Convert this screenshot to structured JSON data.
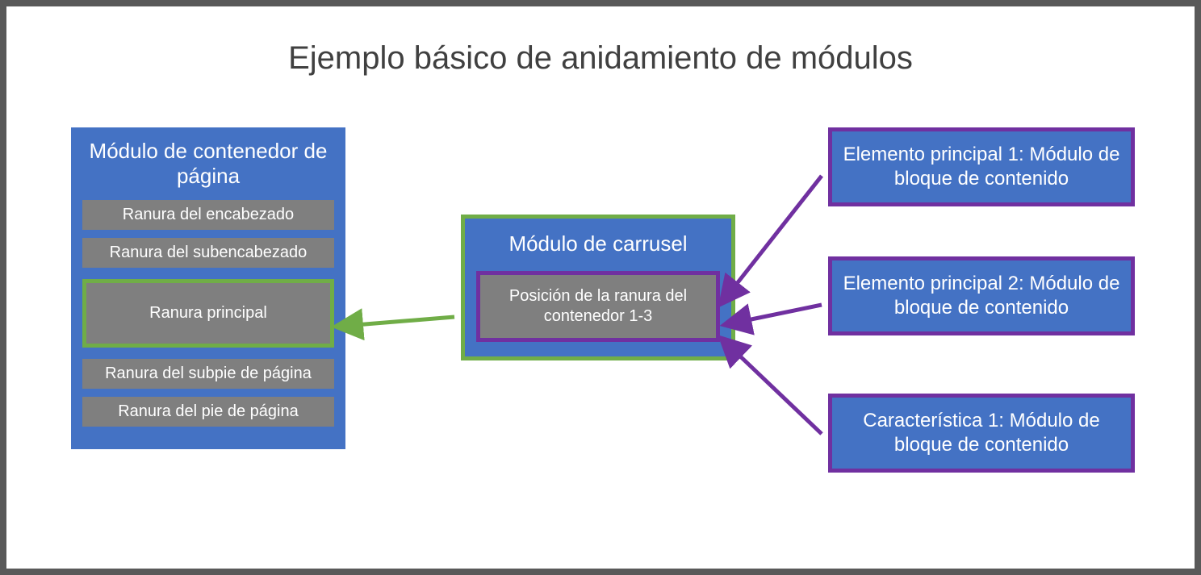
{
  "title": "Ejemplo básico de anidamiento de módulos",
  "pageContainer": {
    "title": "Módulo de contenedor de página",
    "slots": {
      "header": "Ranura del encabezado",
      "subheader": "Ranura del subencabezado",
      "main": "Ranura principal",
      "subfooter": "Ranura del subpie de página",
      "footer": "Ranura del pie de página"
    }
  },
  "carousel": {
    "title": "Módulo de carrusel",
    "slot": "Posición de la ranura del contenedor 1-3"
  },
  "contentBlocks": {
    "item1": "Elemento principal 1: Módulo de bloque de contenido",
    "item2": "Elemento principal 2: Módulo de bloque de contenido",
    "item3": "Característica 1: Módulo de bloque de contenido"
  },
  "colors": {
    "blue": "#4472c4",
    "gray": "#7f7f7f",
    "green": "#70ad47",
    "purple": "#7030a0",
    "frame": "#595959"
  }
}
